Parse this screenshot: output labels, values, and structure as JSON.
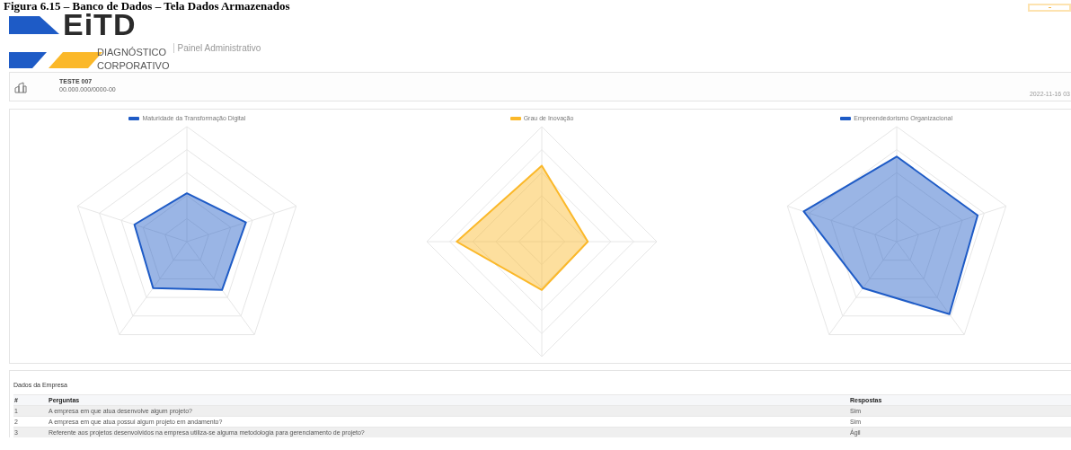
{
  "caption": "Figura 6.15 – Banco de Dados – Tela Dados Armazenados",
  "logo": {
    "mark": "EiTD",
    "line_1": "DIAGNÓSTICO",
    "line_2": "CORPORATIVO"
  },
  "app_title": "Painel Administrativo",
  "company": {
    "name": "TESTE 007",
    "cnpj": "00.000.000/0000-00",
    "date": "2022-11-16 03"
  },
  "charts": [
    {
      "legend": "Maturidade da Transformação Digital",
      "color": "#1e5bc6"
    },
    {
      "legend": "Grau de Inovação",
      "color": "#fbb829"
    },
    {
      "legend": "Empreendedorismo Organizacional",
      "color": "#1e5bc6"
    }
  ],
  "table": {
    "title": "Dados da Empresa",
    "columns": [
      "#",
      "Perguntas",
      "Respostas"
    ],
    "rows": [
      [
        "1",
        "A empresa em que atua desenvolve algum projeto?",
        "Sim"
      ],
      [
        "2",
        "A empresa em que atua possui algum projeto em andamento?",
        "Sim"
      ],
      [
        "3",
        "Referente aos projetos desenvolvidos na empresa utiliza-se alguma metodologia para gerenciamento de projeto?",
        "Ágil"
      ]
    ]
  }
}
